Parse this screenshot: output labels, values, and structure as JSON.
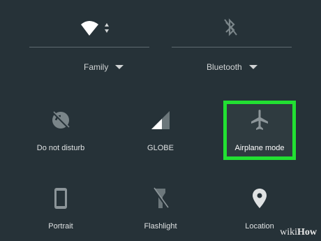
{
  "top": {
    "wifi_icon": "wifi-icon",
    "bluetooth_icon": "bluetooth-off-icon",
    "wifi_network": "Family",
    "bluetooth_label": "Bluetooth"
  },
  "tiles": [
    {
      "label": "Do not disturb",
      "icon": "do-not-disturb-icon"
    },
    {
      "label": "GLOBE",
      "icon": "cell-signal-icon"
    },
    {
      "label": "Airplane mode",
      "icon": "airplane-icon"
    },
    {
      "label": "Portrait",
      "icon": "phone-portrait-icon"
    },
    {
      "label": "Flashlight",
      "icon": "flashlight-icon"
    },
    {
      "label": "Location",
      "icon": "location-pin-icon"
    }
  ],
  "highlight_color": "#22e032",
  "watermark": {
    "part1": "wiki",
    "part2": "How"
  }
}
